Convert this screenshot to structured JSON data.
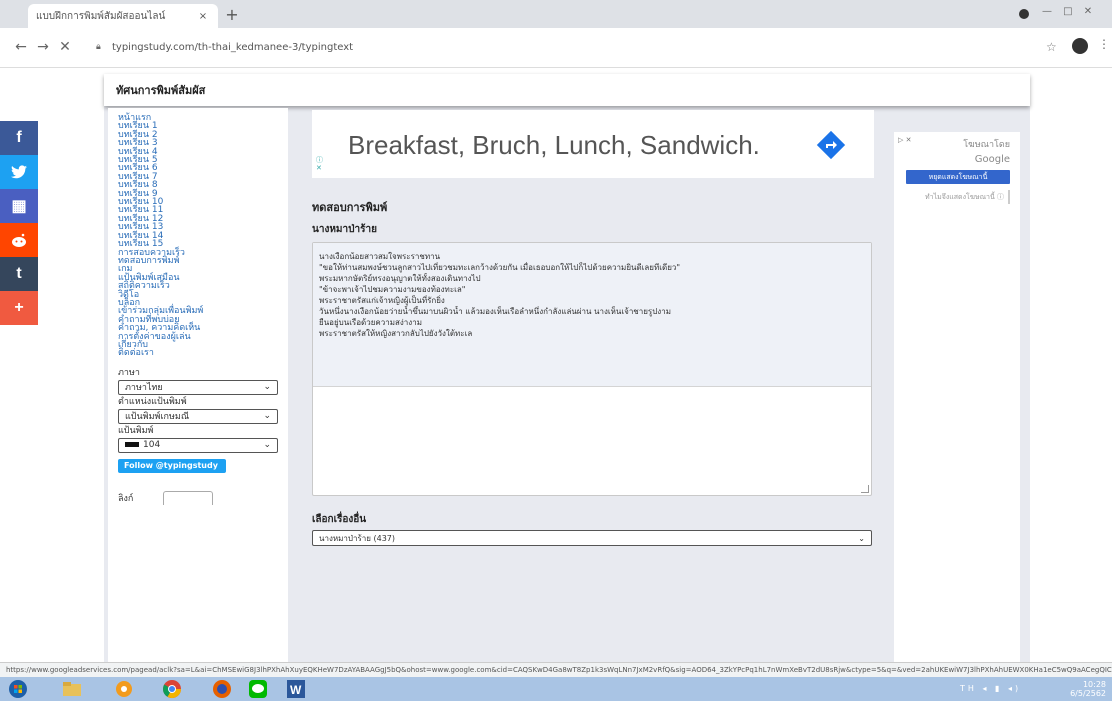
{
  "browser": {
    "tab_title": "แบบฝึกการพิมพ์สัมผัสออนไลน์",
    "tab_close": "×",
    "new_tab": "+",
    "url": "typingstudy.com/th-thai_kedmanee-3/typingtext",
    "window_controls": "— □ ✕"
  },
  "header": {
    "title": "ทัศนการพิมพ์สัมผัส"
  },
  "sidebar": {
    "links": [
      "หน้าแรก",
      "บทเรียน 1",
      "บทเรียน 2",
      "บทเรียน 3",
      "บทเรียน 4",
      "บทเรียน 5",
      "บทเรียน 6",
      "บทเรียน 7",
      "บทเรียน 8",
      "บทเรียน 9",
      "บทเรียน 10",
      "บทเรียน 11",
      "บทเรียน 12",
      "บทเรียน 13",
      "บทเรียน 14",
      "บทเรียน 15",
      "การสอบความเร็ว",
      "ทดสอบการพิมพ์",
      "เกม",
      "แป้นพิมพ์เสมือน",
      "สถิติความเร็ว",
      "วิดีโอ",
      "บล็อก",
      "เข้าร่วมกลุ่มเพื่อนพิมพ์",
      "คำถามที่พบบ่อย",
      "คำถาม, ความคิดเห็น",
      "การตั้งค่าของผู้เล่น",
      "เกี่ยวกับ",
      "ติดต่อเรา"
    ],
    "language_label": "ภาษา",
    "language_value": "ภาษาไทย",
    "layout_label": "ตำแหน่งแป้นพิมพ์",
    "layout_value": "แป้นพิมพ์เกษมณี",
    "keyboard_label": "แป้นพิมพ์",
    "keyboard_value": "104",
    "follow_label": "Follow @typingstudy",
    "footer_label": "ลิงก์"
  },
  "main": {
    "ad_text": "Breakfast, Bruch, Lunch, Sandwich.",
    "ad_info": "ⓘ",
    "ad_close": "✕",
    "typing_test_heading": "ทดสอบการพิมพ์",
    "story_title": "นางหมาป่าร้าย",
    "text_lines": [
      "นางเงือกน้อยสาวสมใจพระราชทาน",
      "\"ขอให้ท่านสมพงษ์ชวนลูกสาวไปเที่ยวชมทะเลกว้างด้วยกัน เมื่อเธอบอกให้ไปก็ไปด้วยความยินดีเลยทีเดียว\"",
      "พระมหากษัตริย์ทรงอนุญาตให้ทั้งสองเดินทางไป",
      "\"ข้าจะพาเจ้าไปชมความงามของท้องทะเล\"",
      "พระราชาตรัสแก่เจ้าหญิงผู้เป็นที่รักยิ่ง",
      "วันหนึ่งนางเงือกน้อยว่ายน้ำขึ้นมาบนผิวน้ำ แล้วมองเห็นเรือลำหนึ่งกำลังแล่นผ่าน นางเห็นเจ้าชายรูปงาม",
      "ยืนอยู่บนเรือด้วยความสง่างาม",
      "พระราชาตรัสให้หญิงสาวกลับไปยังวังใต้ทะเล"
    ],
    "choose_story_label": "เลือกเรื่องอื่น",
    "story_select_value": "นางหมาป่าร้าย (437)"
  },
  "right_ad": {
    "adchoice": "▷ ✕",
    "search_note": "โฆษณาโดย",
    "google_label": "Google",
    "report_button": "หยุดแสดงโฆษณานี้",
    "why_button": "ทำไมจึงแสดงโฆษณานี้ ⓘ"
  },
  "share": {
    "facebook": "f",
    "twitter": "t",
    "grid": "▦",
    "reddit": "r",
    "tumblr": "t",
    "more": "+"
  },
  "status": {
    "url": "https://www.googleadservices.com/pagead/aclk?sa=L&ai=ChMSEwiG8J3lhPXhAhXuyEQKHeW7DzAYABAAGgJ5bQ&ohost=www.google.com&cid=CAQSKwD4Ga8wT8Zp1k3sWqLNn7JxM2vRfQ&sig=AOD64_3ZkYPcPq1hL7nWmXeBvT2dU8sRjw&ctype=5&q=&ved=2ahUKEwiW7J3lhPXhAhUEWX0KHa1eC5wQ9aACegQIChAB&adurl="
  },
  "taskbar": {
    "tray": "TH ◂ ▮ ◂)",
    "time": "10:28",
    "date": "6/5/2562"
  },
  "colors": {
    "facebook": "#3b5998",
    "twitter": "#1da1f2",
    "grid": "#4a5fc1",
    "reddit": "#ff4500",
    "tumblr": "#35465c",
    "more": "#f05a40",
    "ad_arrow": "#1a73e8"
  }
}
